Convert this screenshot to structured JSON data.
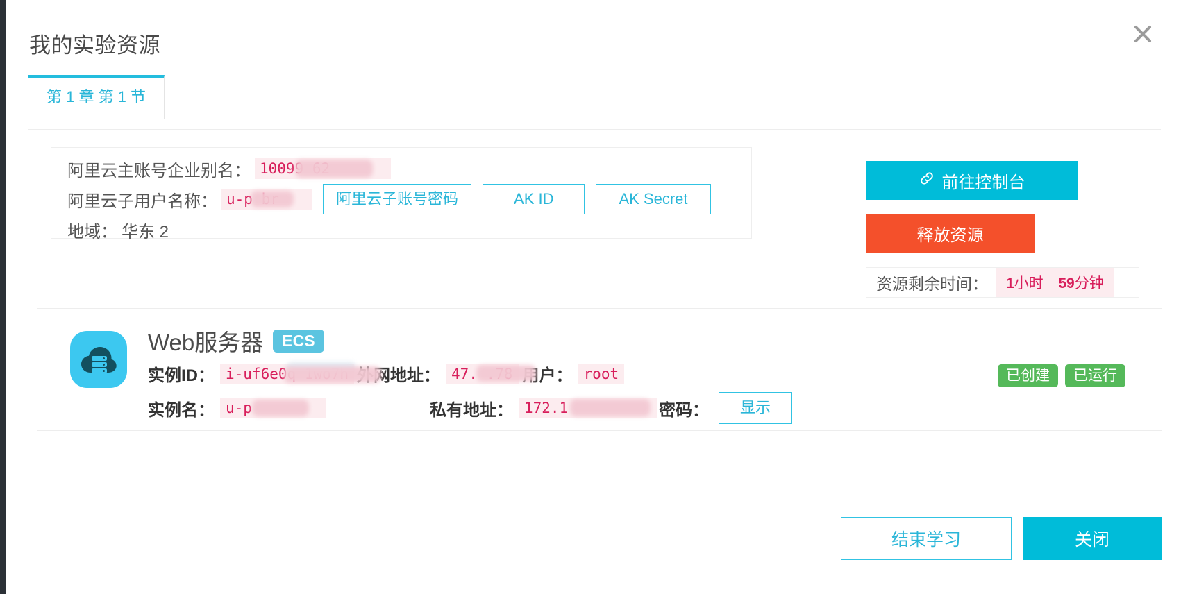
{
  "window": {
    "title": "我的实验资源",
    "close_icon": "close-icon"
  },
  "tabs": [
    {
      "label": "第 1 章 第 1 节",
      "active": true
    }
  ],
  "account_info": {
    "rows": [
      {
        "label": "阿里云主账号企业别名：",
        "value": "10099            62",
        "masked": true
      },
      {
        "label": "阿里云子用户名称：",
        "value": "u-p          br",
        "masked": true
      },
      {
        "label": "地域：",
        "value": "华东 2",
        "masked": false
      }
    ],
    "buttons": [
      {
        "label": "阿里云子账号密码"
      },
      {
        "label": "AK ID"
      },
      {
        "label": "AK Secret"
      }
    ]
  },
  "actions": {
    "console_button": {
      "label": "前往控制台",
      "icon": "link-icon",
      "color": "#00bcd9"
    },
    "release_button": {
      "label": "释放资源",
      "color": "#f4502b"
    },
    "remaining_time": {
      "label": "资源剩余时间：",
      "hours": "1",
      "hours_unit": "小时",
      "minutes": "59",
      "minutes_unit": "分钟"
    }
  },
  "resource": {
    "icon": "ecs-cloud-server-icon",
    "name": "Web服务器",
    "badge": "ECS",
    "fields": {
      "instance_id_label": "实例ID：",
      "instance_id_value": "i-uf6e0q           1wo7h",
      "public_ip_label": "外网地址：",
      "public_ip_value": "47.            .78",
      "user_label": "用户：",
      "user_value": "root",
      "instance_name_label": "实例名：",
      "instance_name_value": "u-p          ",
      "private_ip_label": "私有地址：",
      "private_ip_value": "172.1           ",
      "password_label": "密码：",
      "password_button": "显示"
    },
    "status": [
      {
        "label": "已创建",
        "color": "#55b95a"
      },
      {
        "label": "已运行",
        "color": "#55b95a"
      }
    ]
  },
  "footer": {
    "finish_button": "结束学习",
    "close_button": "关闭"
  }
}
